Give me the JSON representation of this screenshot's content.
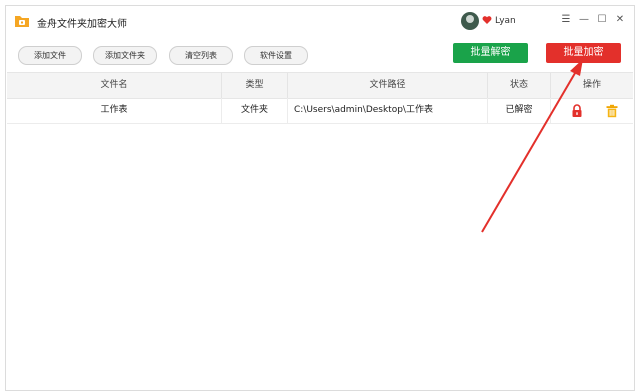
{
  "app": {
    "title": "金舟文件夹加密大师"
  },
  "user": {
    "name": "Lyan"
  },
  "window_controls": {
    "menu": "☰",
    "minimize": "—",
    "maximize": "☐",
    "close": "✕"
  },
  "toolbar": {
    "add_file": "添加文件",
    "add_folder": "添加文件夹",
    "clear_list": "清空列表",
    "settings": "软件设置",
    "batch_decrypt": "批量解密",
    "batch_encrypt": "批量加密"
  },
  "table": {
    "headers": {
      "name": "文件名",
      "type": "类型",
      "path": "文件路径",
      "status": "状态",
      "actions": "操作"
    },
    "rows": [
      {
        "name": "工作表",
        "type": "文件夹",
        "path": "C:\\Users\\admin\\Desktop\\工作表",
        "status": "已解密",
        "actions": [
          "lock-icon",
          "trash-icon"
        ]
      }
    ]
  },
  "colors": {
    "accent_green": "#1aa34a",
    "accent_red": "#e3302b",
    "arrow_red": "#e3302b",
    "logo_orange": "#f5a623"
  }
}
